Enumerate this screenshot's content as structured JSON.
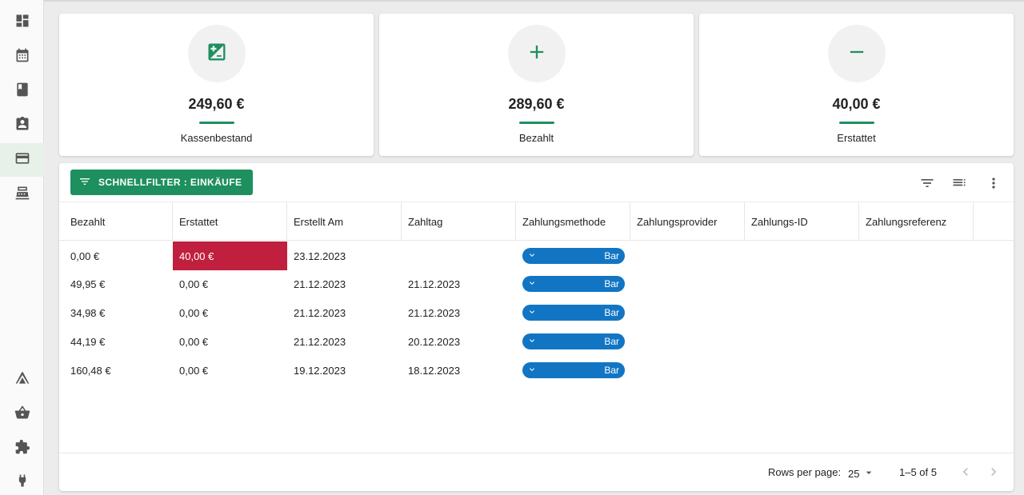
{
  "sidebar": {
    "items": [
      {
        "icon": "dashboard-icon"
      },
      {
        "icon": "calendar-icon"
      },
      {
        "icon": "book-icon"
      },
      {
        "icon": "contact-card-icon"
      },
      {
        "icon": "credit-card-icon",
        "active": true
      },
      {
        "icon": "cash-register-icon"
      },
      {
        "icon": "tent-icon"
      },
      {
        "icon": "basket-icon"
      },
      {
        "icon": "puzzle-icon"
      },
      {
        "icon": "plug-icon"
      }
    ]
  },
  "cards": [
    {
      "icon": "balance-icon",
      "value": "249,60 €",
      "label": "Kassenbestand"
    },
    {
      "icon": "plus-icon",
      "value": "289,60 €",
      "label": "Bezahlt"
    },
    {
      "icon": "minus-icon",
      "value": "40,00 €",
      "label": "Erstattet"
    }
  ],
  "toolbar": {
    "filter_label": "SCHNELLFILTER : EINKÄUFE",
    "icons": [
      "filter-icon",
      "columns-icon",
      "more-vert-icon"
    ]
  },
  "table": {
    "columns": [
      "Bezahlt",
      "Erstattet",
      "Erstellt Am",
      "Zahltag",
      "Zahlungsmethode",
      "Zahlungsprovider",
      "Zahlungs-ID",
      "Zahlungsreferenz"
    ],
    "rows": [
      {
        "bezahlt": "0,00 €",
        "erstattet": "40,00 €",
        "erstellt": "23.12.2023",
        "zahltag": "",
        "methode": "Bar",
        "highlight": true
      },
      {
        "bezahlt": "49,95 €",
        "erstattet": "0,00 €",
        "erstellt": "21.12.2023",
        "zahltag": "21.12.2023",
        "methode": "Bar"
      },
      {
        "bezahlt": "34,98 €",
        "erstattet": "0,00 €",
        "erstellt": "21.12.2023",
        "zahltag": "21.12.2023",
        "methode": "Bar"
      },
      {
        "bezahlt": "44,19 €",
        "erstattet": "0,00 €",
        "erstellt": "21.12.2023",
        "zahltag": "20.12.2023",
        "methode": "Bar"
      },
      {
        "bezahlt": "160,48 €",
        "erstattet": "0,00 €",
        "erstellt": "19.12.2023",
        "zahltag": "18.12.2023",
        "methode": "Bar"
      }
    ]
  },
  "pagination": {
    "rows_per_page_label": "Rows per page:",
    "rows_per_page": "25",
    "range": "1–5 of 5"
  },
  "colors": {
    "accent": "#1e8f5e",
    "pill": "#1275c4",
    "refund_highlight": "#c0203e"
  }
}
